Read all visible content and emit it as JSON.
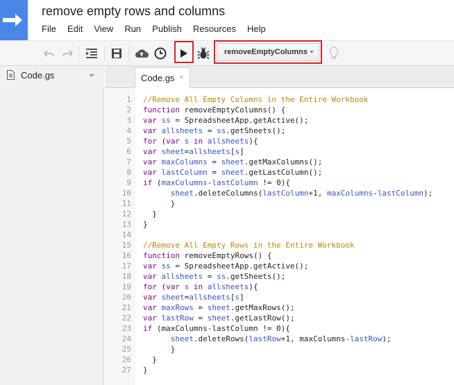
{
  "header": {
    "title": "remove empty rows and columns",
    "menu": [
      "File",
      "Edit",
      "View",
      "Run",
      "Publish",
      "Resources",
      "Help"
    ]
  },
  "toolbar": {
    "selected_function": "removeEmptyColumns",
    "icons": [
      "undo-icon",
      "redo-icon",
      "indent-icon",
      "save-icon",
      "cloud-upload-icon",
      "clock-icon",
      "run-icon",
      "debug-icon",
      "lightbulb-icon"
    ]
  },
  "left_panel": {
    "file_name": "Code.gs"
  },
  "editor": {
    "tab_label": "Code.gs",
    "tab_close": "×",
    "lines": [
      {
        "n": "1",
        "parts": [
          [
            "comment",
            "//Remove All Empty Columns in the Entire Workbook"
          ]
        ]
      },
      {
        "n": "2",
        "parts": [
          [
            "kw",
            "function"
          ],
          [
            "plain",
            " removeEmptyColumns() {"
          ]
        ]
      },
      {
        "n": "3",
        "parts": [
          [
            "kw",
            "var"
          ],
          [
            "plain",
            " "
          ],
          [
            "var",
            "ss"
          ],
          [
            "plain",
            " = SpreadsheetApp.getActive();"
          ]
        ]
      },
      {
        "n": "4",
        "parts": [
          [
            "kw",
            "var"
          ],
          [
            "plain",
            " "
          ],
          [
            "var",
            "allsheets"
          ],
          [
            "plain",
            " = "
          ],
          [
            "var",
            "ss"
          ],
          [
            "plain",
            ".getSheets();"
          ]
        ]
      },
      {
        "n": "5",
        "parts": [
          [
            "kw",
            "for"
          ],
          [
            "plain",
            " ("
          ],
          [
            "kw",
            "var"
          ],
          [
            "plain",
            " "
          ],
          [
            "var",
            "s"
          ],
          [
            "plain",
            " "
          ],
          [
            "kw",
            "in"
          ],
          [
            "plain",
            " "
          ],
          [
            "var",
            "allsheets"
          ],
          [
            "plain",
            "){"
          ]
        ]
      },
      {
        "n": "6",
        "parts": [
          [
            "kw",
            "var"
          ],
          [
            "plain",
            " "
          ],
          [
            "var",
            "sheet"
          ],
          [
            "plain",
            "="
          ],
          [
            "var",
            "allsheets"
          ],
          [
            "plain",
            "["
          ],
          [
            "var",
            "s"
          ],
          [
            "plain",
            "]"
          ]
        ]
      },
      {
        "n": "7",
        "parts": [
          [
            "kw",
            "var"
          ],
          [
            "plain",
            " "
          ],
          [
            "var",
            "maxColumns"
          ],
          [
            "plain",
            " = "
          ],
          [
            "var",
            "sheet"
          ],
          [
            "plain",
            ".getMaxColumns();"
          ]
        ]
      },
      {
        "n": "8",
        "parts": [
          [
            "kw",
            "var"
          ],
          [
            "plain",
            " "
          ],
          [
            "var",
            "lastColumn"
          ],
          [
            "plain",
            " = "
          ],
          [
            "var",
            "sheet"
          ],
          [
            "plain",
            ".getLastColumn();"
          ]
        ]
      },
      {
        "n": "9",
        "parts": [
          [
            "kw",
            "if"
          ],
          [
            "plain",
            " ("
          ],
          [
            "var",
            "maxColumns"
          ],
          [
            "plain",
            "-"
          ],
          [
            "var",
            "lastColumn"
          ],
          [
            "plain",
            " != 0){"
          ]
        ]
      },
      {
        "n": "10",
        "parts": [
          [
            "plain",
            "      "
          ],
          [
            "var",
            "sheet"
          ],
          [
            "plain",
            ".deleteColumns("
          ],
          [
            "var",
            "lastColumn"
          ],
          [
            "plain",
            "+1, "
          ],
          [
            "var",
            "maxColumns"
          ],
          [
            "plain",
            "-"
          ],
          [
            "var",
            "lastColumn"
          ],
          [
            "plain",
            ");"
          ]
        ]
      },
      {
        "n": "11",
        "parts": [
          [
            "plain",
            "      }"
          ]
        ]
      },
      {
        "n": "12",
        "parts": [
          [
            "plain",
            "  }"
          ]
        ]
      },
      {
        "n": "13",
        "parts": [
          [
            "plain",
            "}"
          ]
        ]
      },
      {
        "n": "14",
        "parts": [
          [
            "plain",
            ""
          ]
        ]
      },
      {
        "n": "15",
        "parts": [
          [
            "comment",
            "//Remove All Empty Rows in the Entire Workbook"
          ]
        ]
      },
      {
        "n": "16",
        "parts": [
          [
            "kw",
            "function"
          ],
          [
            "plain",
            " removeEmptyRows() {"
          ]
        ]
      },
      {
        "n": "17",
        "parts": [
          [
            "kw",
            "var"
          ],
          [
            "plain",
            " "
          ],
          [
            "var",
            "ss"
          ],
          [
            "plain",
            " = SpreadsheetApp.getActive();"
          ]
        ]
      },
      {
        "n": "18",
        "parts": [
          [
            "kw",
            "var"
          ],
          [
            "plain",
            " "
          ],
          [
            "var",
            "allsheets"
          ],
          [
            "plain",
            " = "
          ],
          [
            "var",
            "ss"
          ],
          [
            "plain",
            ".getSheets();"
          ]
        ]
      },
      {
        "n": "19",
        "parts": [
          [
            "kw",
            "for"
          ],
          [
            "plain",
            " ("
          ],
          [
            "kw",
            "var"
          ],
          [
            "plain",
            " "
          ],
          [
            "var",
            "s"
          ],
          [
            "plain",
            " "
          ],
          [
            "kw",
            "in"
          ],
          [
            "plain",
            " "
          ],
          [
            "var",
            "allsheets"
          ],
          [
            "plain",
            "){"
          ]
        ]
      },
      {
        "n": "20",
        "parts": [
          [
            "kw",
            "var"
          ],
          [
            "plain",
            " "
          ],
          [
            "var",
            "sheet"
          ],
          [
            "plain",
            "="
          ],
          [
            "var",
            "allsheets"
          ],
          [
            "plain",
            "["
          ],
          [
            "var",
            "s"
          ],
          [
            "plain",
            "]"
          ]
        ]
      },
      {
        "n": "21",
        "parts": [
          [
            "kw",
            "var"
          ],
          [
            "plain",
            " "
          ],
          [
            "var",
            "maxRows"
          ],
          [
            "plain",
            " = "
          ],
          [
            "var",
            "sheet"
          ],
          [
            "plain",
            ".getMaxRows();"
          ]
        ]
      },
      {
        "n": "22",
        "parts": [
          [
            "kw",
            "var"
          ],
          [
            "plain",
            " "
          ],
          [
            "var",
            "lastRow"
          ],
          [
            "plain",
            " = "
          ],
          [
            "var",
            "sheet"
          ],
          [
            "plain",
            ".getLastRow();"
          ]
        ]
      },
      {
        "n": "23",
        "parts": [
          [
            "kw",
            "if"
          ],
          [
            "plain",
            " (maxColumns-lastColumn != 0){"
          ]
        ]
      },
      {
        "n": "24",
        "parts": [
          [
            "plain",
            "      "
          ],
          [
            "var",
            "sheet"
          ],
          [
            "plain",
            ".deleteRows("
          ],
          [
            "var",
            "lastRow"
          ],
          [
            "plain",
            "+1, maxColumns-"
          ],
          [
            "var",
            "lastRow"
          ],
          [
            "plain",
            ");"
          ]
        ]
      },
      {
        "n": "25",
        "parts": [
          [
            "plain",
            "      }"
          ]
        ]
      },
      {
        "n": "26",
        "parts": [
          [
            "plain",
            "  }"
          ]
        ]
      },
      {
        "n": "27",
        "parts": [
          [
            "plain",
            "}"
          ]
        ]
      }
    ]
  },
  "colors": {
    "logo": "#4a86e8",
    "highlight": "#d8232a",
    "comment": "#b8860b",
    "keyword": "#8b008b",
    "variable": "#3552c8"
  }
}
